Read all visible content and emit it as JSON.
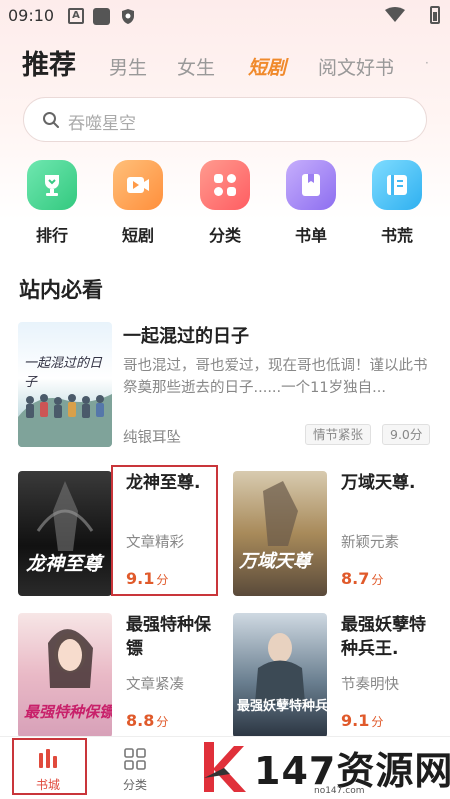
{
  "status_bar": {
    "time": "09:10",
    "icons": [
      "a-notification-icon",
      "square-notification-icon",
      "shield-notification-icon",
      "wifi-icon",
      "battery-icon"
    ]
  },
  "tabs": [
    "推荐",
    "男生",
    "女生",
    "短剧",
    "阅文好书"
  ],
  "active_tab": "推荐",
  "search": {
    "placeholder": "吞噬星空"
  },
  "categories": [
    {
      "label": "排行",
      "icon": "trophy-icon",
      "color": "#4fd89a"
    },
    {
      "label": "短剧",
      "icon": "video-icon",
      "color": "#ffa55a"
    },
    {
      "label": "分类",
      "icon": "grid-icon",
      "color": "#ff7a78"
    },
    {
      "label": "书单",
      "icon": "booklist-icon",
      "color": "#a98cf5"
    },
    {
      "label": "书荒",
      "icon": "book-icon",
      "color": "#4cc2f5"
    }
  ],
  "section_title": "站内必看",
  "featured_book": {
    "title": "一起混过的日子",
    "description": "哥也混过，哥也爱过，现在哥也低调！谨以此书祭奠那些逝去的日子......一个11岁独自...",
    "author": "纯银耳坠",
    "tag": "情节紧张",
    "score": "9.0分",
    "cover_text": "一起混过的日子"
  },
  "books": [
    {
      "title": "龙神至尊.",
      "author": "文章精彩",
      "score": "9.1",
      "unit": "分",
      "cover_text": "龙神至尊"
    },
    {
      "title": "万域天尊.",
      "author": "新颖元素",
      "score": "8.7",
      "unit": "分",
      "cover_text": "万域天尊"
    },
    {
      "title": "最强特种保镖",
      "author": "文章紧凑",
      "score": "8.8",
      "unit": "分",
      "cover_text": "最强特种保镖"
    },
    {
      "title": "最强妖孽特种兵王.",
      "author": "节奏明快",
      "score": "9.1",
      "unit": "分",
      "cover_text": "最强妖孽特种兵王"
    }
  ],
  "bottom_nav": [
    {
      "label": "书城",
      "icon": "bookstore-icon",
      "active": true
    },
    {
      "label": "分类",
      "icon": "category-grid-icon",
      "active": false
    }
  ],
  "watermark": {
    "text": "147资源网",
    "sub": "no147.com"
  },
  "colors": {
    "accent": "#e04a3c",
    "score": "#e05a2b",
    "featured_tab": "#f08a2c",
    "highlight": "#c9353a"
  }
}
